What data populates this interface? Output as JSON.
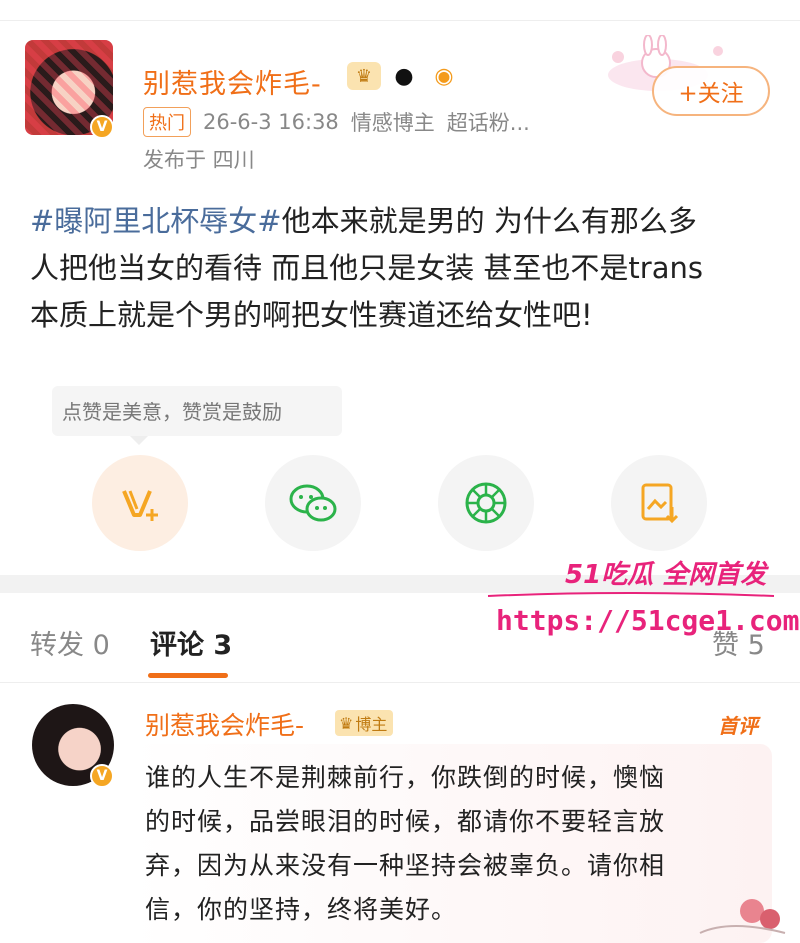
{
  "post": {
    "username": "别惹我会炸毛-",
    "hot_tag": "热门",
    "datetime": "26-6-3 16:38",
    "author_type": "情感博主",
    "supertopic": "超话粉...",
    "location": "发布于 四川",
    "follow_label": "+关注",
    "content": {
      "hashtag": "#曝阿里北杯辱女#",
      "line1_rest": "他本来就是男的 为什么有那么多",
      "line2": "人把他当女的看待 而且他只是女装 甚至也不是trans",
      "line3": "本质上就是个男的啊把女性赛道还给女性吧!"
    },
    "tip": "点赞是美意，赞赏是鼓励"
  },
  "watermark": {
    "line1": "51吃瓜 全网首发",
    "line2": "https://51cge1.com"
  },
  "tabs": {
    "repost": "转发 0",
    "comments": "评论 3",
    "likes": "赞 5"
  },
  "comment": {
    "username": "别惹我会炸毛-",
    "badge": "博主",
    "first_label": "首评",
    "line1": "谁的人生不是荆棘前行，你跌倒的时候，懊恼",
    "line2": "的时候，品尝眼泪的时候，都请你不要轻言放",
    "line3": "弃，因为从来没有一种坚持会被辜负。请你相",
    "line4": "信，你的坚持，终将美好。"
  },
  "colors": {
    "accent": "#f06f18",
    "hashtag": "#4a6c9b",
    "watermark": "#e8237b"
  }
}
